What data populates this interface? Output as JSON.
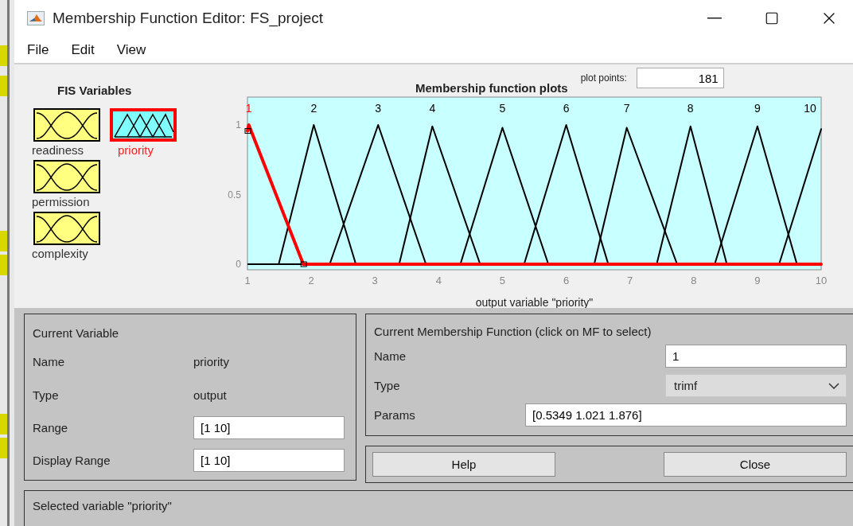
{
  "window": {
    "title": "Membership Function Editor: FS_project"
  },
  "menu": [
    "File",
    "Edit",
    "View"
  ],
  "fis_variables": {
    "title": "FIS Variables",
    "items": [
      {
        "name": "readiness",
        "kind": "input",
        "selected": false
      },
      {
        "name": "priority",
        "kind": "output",
        "selected": true
      },
      {
        "name": "permission",
        "kind": "input",
        "selected": false
      },
      {
        "name": "complexity",
        "kind": "input",
        "selected": false
      }
    ]
  },
  "plot": {
    "plot_points_label": "plot points:",
    "plot_points": "181",
    "chart_data": {
      "type": "line",
      "title": "Membership function plots",
      "xlabel": "output variable \"priority\"",
      "xlim": [
        1,
        10
      ],
      "ylim": [
        -0.04,
        1.2
      ],
      "xticks": [
        1,
        2,
        3,
        4,
        5,
        6,
        7,
        8,
        9,
        10
      ],
      "yticks": [
        0,
        0.5,
        1
      ],
      "series": [
        {
          "name": "1",
          "color": "#ff0000",
          "x": [
            1,
            1.021,
            1.876,
            10
          ],
          "values": [
            0.957,
            1,
            0,
            0
          ]
        },
        {
          "name": "2",
          "color": "#000000",
          "x": [
            1.49,
            2.04,
            2.7
          ],
          "values": [
            0,
            1,
            0
          ]
        },
        {
          "name": "3",
          "color": "#000000",
          "x": [
            2.29,
            3.05,
            3.8
          ],
          "values": [
            0,
            1,
            0
          ]
        },
        {
          "name": "4",
          "color": "#000000",
          "x": [
            3.38,
            3.9,
            4.65
          ],
          "values": [
            0,
            0.99,
            0
          ]
        },
        {
          "name": "5",
          "color": "#000000",
          "x": [
            4.34,
            5,
            5.72
          ],
          "values": [
            0,
            0.98,
            0
          ]
        },
        {
          "name": "6",
          "color": "#000000",
          "x": [
            5.34,
            6,
            6.66
          ],
          "values": [
            0,
            1,
            0
          ]
        },
        {
          "name": "7",
          "color": "#000000",
          "x": [
            6.44,
            6.95,
            7.74
          ],
          "values": [
            0,
            0.98,
            0
          ]
        },
        {
          "name": "8",
          "color": "#000000",
          "x": [
            7.42,
            7.95,
            8.52
          ],
          "values": [
            0,
            0.99,
            0
          ]
        },
        {
          "name": "9",
          "color": "#000000",
          "x": [
            8.33,
            9,
            9.62
          ],
          "values": [
            0,
            0.99,
            0
          ]
        },
        {
          "name": "10",
          "color": "#000000",
          "x": [
            9.34,
            10
          ],
          "values": [
            0,
            0.97
          ]
        }
      ]
    }
  },
  "current_variable": {
    "title": "Current Variable",
    "name_label": "Name",
    "name": "priority",
    "type_label": "Type",
    "type": "output",
    "range_label": "Range",
    "range": "[1 10]",
    "display_range_label": "Display Range",
    "display_range": "[1 10]"
  },
  "current_mf": {
    "title": "Current Membership Function (click on MF to select)",
    "name_label": "Name",
    "name": "1",
    "type_label": "Type",
    "type": "trimf",
    "params_label": "Params",
    "params": "[0.5349 1.021 1.876]"
  },
  "buttons": [
    "Help",
    "Close"
  ],
  "status_bar": "Selected variable \"priority\""
}
